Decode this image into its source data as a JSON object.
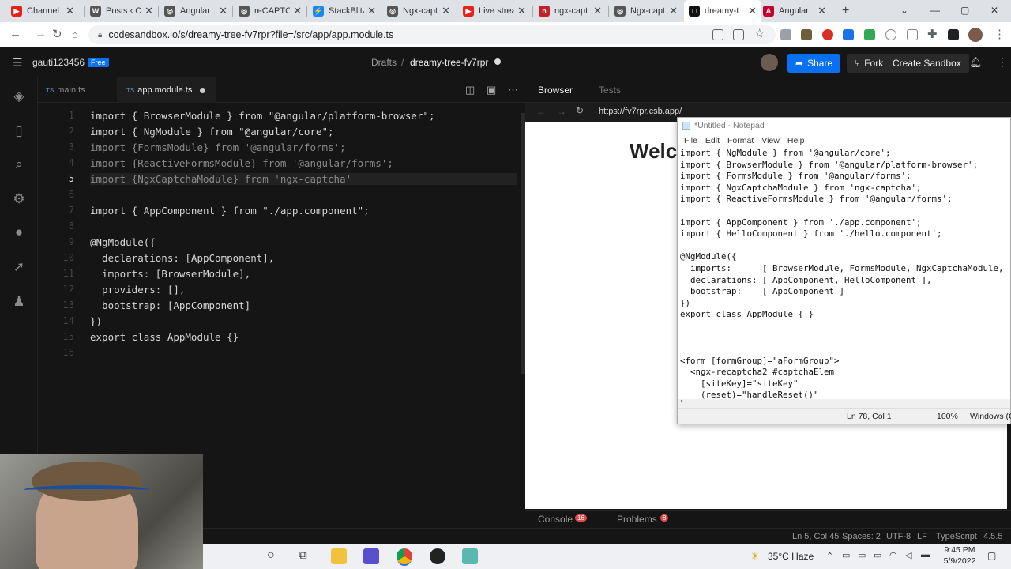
{
  "browser": {
    "tabs": [
      {
        "title": "Channel",
        "color": "#e62117",
        "glyph": "▶"
      },
      {
        "title": "Posts ‹ C",
        "color": "#555",
        "glyph": "W"
      },
      {
        "title": "Angular",
        "color": "#555",
        "glyph": "◎"
      },
      {
        "title": "reCAPTCH",
        "color": "#555",
        "glyph": "◎"
      },
      {
        "title": "StackBlitz",
        "color": "#1389fd",
        "glyph": "⚡"
      },
      {
        "title": "Ngx-capt",
        "color": "#555",
        "glyph": "◎"
      },
      {
        "title": "Live strea",
        "color": "#e62117",
        "glyph": "▶"
      },
      {
        "title": "ngx-capt",
        "color": "#c12127",
        "glyph": "n"
      },
      {
        "title": "Ngx-capt",
        "color": "#555",
        "glyph": "◎"
      },
      {
        "title": "dreamy-t",
        "color": "#111",
        "glyph": "□",
        "active": true
      },
      {
        "title": "Angular",
        "color": "#c3002f",
        "glyph": "A"
      }
    ],
    "url": "codesandbox.io/s/dreamy-tree-fv7rpr?file=/src/app/app.module.ts"
  },
  "header": {
    "user": "gauti123456",
    "badge": "Free",
    "breadcrumb_root": "Drafts",
    "breadcrumb_sep": "/",
    "sandbox_name": "dreamy-tree-fv7rpr",
    "share": "Share",
    "fork": "Fork",
    "create": "Create Sandbox"
  },
  "editor": {
    "tabs": [
      {
        "label": "main.ts",
        "lang": "TS",
        "active": false
      },
      {
        "label": "app.module.ts",
        "lang": "TS",
        "active": true
      }
    ],
    "current_line": "5",
    "lines": [
      {
        "n": "1",
        "text": "import { BrowserModule } from \"@angular/platform-browser\";"
      },
      {
        "n": "2",
        "text": "import { NgModule } from \"@angular/core\";"
      },
      {
        "n": "3",
        "text": "import {FormsModule} from '@angular/forms';"
      },
      {
        "n": "4",
        "text": "import {ReactiveFormsModule} from '@angular/forms';"
      },
      {
        "n": "5",
        "text": "import {NgxCaptchaModule} from 'ngx-captcha'"
      },
      {
        "n": "6",
        "text": ""
      },
      {
        "n": "7",
        "text": "import { AppComponent } from \"./app.component\";"
      },
      {
        "n": "8",
        "text": ""
      },
      {
        "n": "9",
        "text": "@NgModule({"
      },
      {
        "n": "10",
        "text": "  declarations: [AppComponent],"
      },
      {
        "n": "11",
        "text": "  imports: [BrowserModule],"
      },
      {
        "n": "12",
        "text": "  providers: [],"
      },
      {
        "n": "13",
        "text": "  bootstrap: [AppComponent]"
      },
      {
        "n": "14",
        "text": "})"
      },
      {
        "n": "15",
        "text": "export class AppModule {}"
      },
      {
        "n": "16",
        "text": ""
      }
    ]
  },
  "preview": {
    "tab_browser": "Browser",
    "tab_tests": "Tests",
    "url": "https://fv7rpr.csb.app/",
    "heading": "Welc",
    "console": "Console",
    "console_count": "16",
    "problems": "Problems",
    "problems_count": "8"
  },
  "notepad": {
    "title": "*Untitled - Notepad",
    "menu": [
      "File",
      "Edit",
      "Format",
      "View",
      "Help"
    ],
    "text": "import { NgModule } from '@angular/core';\nimport { BrowserModule } from '@angular/platform-browser';\nimport { FormsModule } from '@angular/forms';\nimport { NgxCaptchaModule } from 'ngx-captcha';\nimport { ReactiveFormsModule } from '@angular/forms';\n\nimport { AppComponent } from './app.component';\nimport { HelloComponent } from './hello.component';\n\n@NgModule({\n  imports:      [ BrowserModule, FormsModule, NgxCaptchaModule,\n  declarations: [ AppComponent, HelloComponent ],\n  bootstrap:    [ AppComponent ]\n})\nexport class AppModule { }\n\n\n\n<form [formGroup]=\"aFormGroup\">\n  <ngx-recaptcha2 #captchaElem\n    [siteKey]=\"siteKey\"\n    (reset)=\"handleReset()\"",
    "position": "Ln 78, Col 1",
    "zoom": "100%",
    "eol": "Windows (CR"
  },
  "statusbar": {
    "position": "Ln 5, Col 45",
    "spaces": "Spaces: 2",
    "encoding": "UTF-8",
    "eol": "LF",
    "language": "TypeScript",
    "version": "4.5.5"
  },
  "taskbar": {
    "weather": "35°C Haze",
    "time": "9:45 PM",
    "date": "5/9/2022"
  }
}
